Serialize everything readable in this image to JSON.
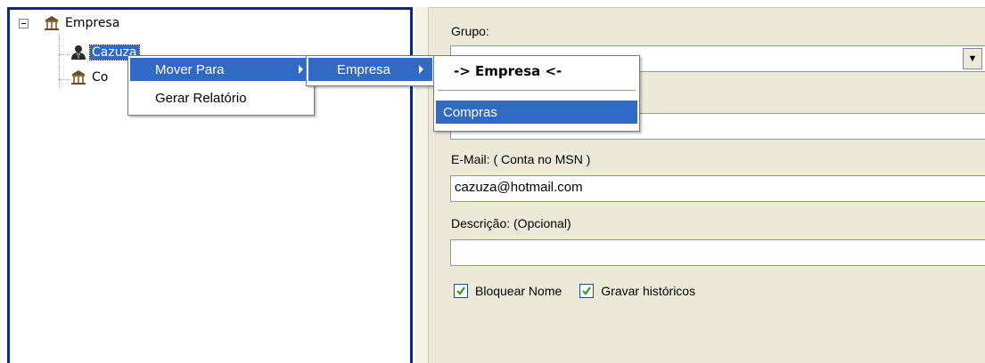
{
  "tree": {
    "root_label": "Empresa",
    "selected_label": "Cazuza",
    "child2_label": "Co"
  },
  "context_menu": {
    "items": [
      {
        "label": "Mover Para"
      },
      {
        "label": "Gerar Relatório"
      }
    ]
  },
  "submenu_1": {
    "items": [
      {
        "label": "Empresa"
      }
    ]
  },
  "submenu_2": {
    "header": "-> Empresa <-",
    "items": [
      {
        "label": "Compras"
      }
    ]
  },
  "form": {
    "grupo_label": "Grupo:",
    "grupo_value": "",
    "nome_value": "",
    "email_label": "E-Mail: ( Conta no MSN )",
    "email_value": "cazuza@hotmail.com",
    "descricao_label": "Descrição: (Opcional)",
    "descricao_value": "",
    "checkbox_bloquear_label": "Bloquear Nome",
    "checkbox_gravar_label": "Gravar históricos",
    "checkbox_bloquear_checked": true,
    "checkbox_gravar_checked": true
  },
  "colors": {
    "selection": "#316ac5",
    "panel_border": "#0a2a8a",
    "form_bg": "#ece9d8",
    "check": "#21a121"
  },
  "icons": {
    "group": "building-icon",
    "contact": "user-icon"
  }
}
